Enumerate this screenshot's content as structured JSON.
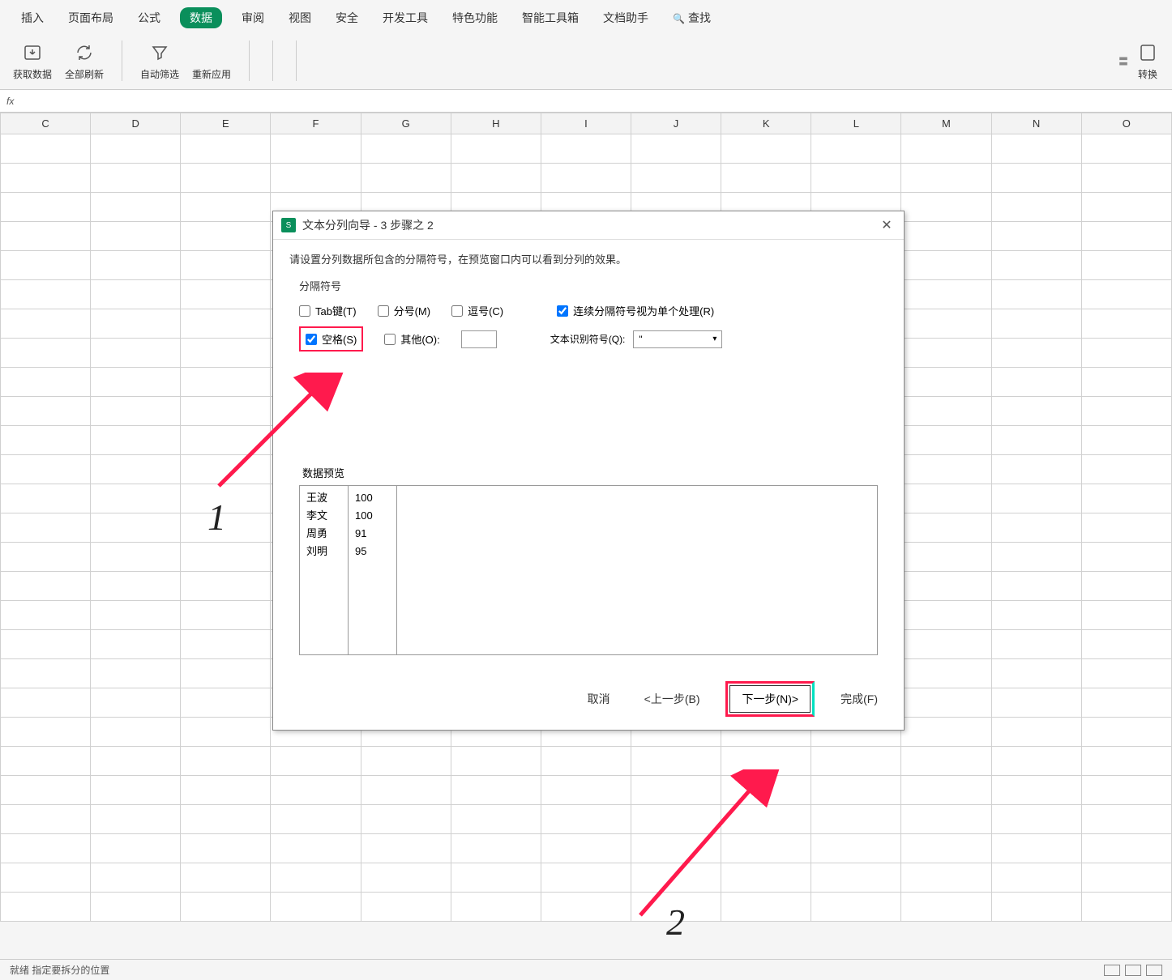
{
  "menu": {
    "items": [
      "插入",
      "页面布局",
      "公式",
      "数据",
      "审阅",
      "视图",
      "安全",
      "开发工具",
      "特色功能",
      "智能工具箱",
      "文档助手"
    ],
    "active_index": 3,
    "search_label": "查找"
  },
  "toolbar": {
    "import_data": "获取数据",
    "refresh_all": "全部刷新",
    "autofilter": "自动筛选",
    "reapply": "重新应用",
    "right_label": "转换"
  },
  "formula_bar": {
    "fx": "fx"
  },
  "columns": [
    "C",
    "D",
    "E",
    "F",
    "G",
    "H",
    "I",
    "J",
    "K",
    "L",
    "M",
    "N",
    "O"
  ],
  "dialog": {
    "title": "文本分列向导 - 3 步骤之 2",
    "instruction": "请设置分列数据所包含的分隔符号，在预览窗口内可以看到分列的效果。",
    "section": "分隔符号",
    "tab": "Tab键(T)",
    "semicolon": "分号(M)",
    "comma": "逗号(C)",
    "space": "空格(S)",
    "other": "其他(O):",
    "consecutive": "连续分隔符号视为单个处理(R)",
    "text_qualifier_label": "文本识别符号(Q):",
    "text_qualifier_value": "\"",
    "preview_label": "数据预览",
    "preview_col1": [
      "王波",
      "李文",
      "周勇",
      "刘明"
    ],
    "preview_col2": [
      "100",
      "100",
      "91",
      "95"
    ],
    "btn_cancel": "取消",
    "btn_back": "<上一步(B)",
    "btn_next": "下一步(N)>",
    "btn_finish": "完成(F)"
  },
  "annotations": {
    "num1": "1",
    "num2": "2"
  },
  "status": {
    "left": "就绪    指定要拆分的位置"
  }
}
